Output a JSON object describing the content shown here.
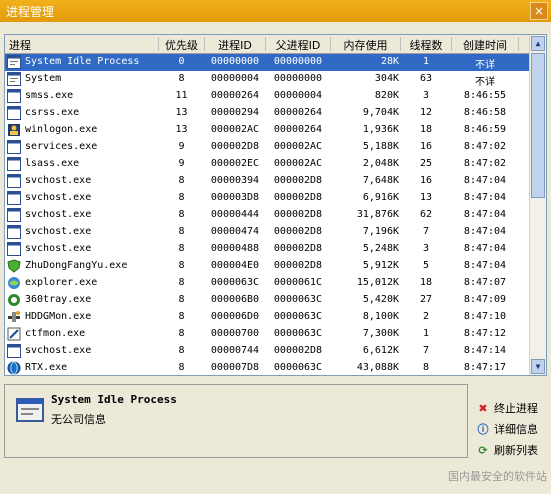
{
  "window": {
    "title": "进程管理",
    "close_label": "×"
  },
  "columns": [
    "进程",
    "优先级",
    "进程ID",
    "父进程ID",
    "内存使用",
    "线程数",
    "创建时间"
  ],
  "processes": [
    {
      "name": "System Idle Process",
      "priority": "0",
      "pid": "00000000",
      "ppid": "00000000",
      "mem": "28K",
      "threads": "1",
      "time": "不详",
      "icon": "window-icon"
    },
    {
      "name": "System",
      "priority": "8",
      "pid": "00000004",
      "ppid": "00000000",
      "mem": "304K",
      "threads": "63",
      "time": "不详",
      "icon": "window-icon"
    },
    {
      "name": "smss.exe",
      "priority": "11",
      "pid": "00000264",
      "ppid": "00000004",
      "mem": "820K",
      "threads": "3",
      "time": "8:46:55",
      "icon": "app-icon"
    },
    {
      "name": "csrss.exe",
      "priority": "13",
      "pid": "00000294",
      "ppid": "00000264",
      "mem": "9,704K",
      "threads": "12",
      "time": "8:46:58",
      "icon": "app-icon"
    },
    {
      "name": "winlogon.exe",
      "priority": "13",
      "pid": "000002AC",
      "ppid": "00000264",
      "mem": "1,936K",
      "threads": "18",
      "time": "8:46:59",
      "icon": "winlogon-icon"
    },
    {
      "name": "services.exe",
      "priority": "9",
      "pid": "000002D8",
      "ppid": "000002AC",
      "mem": "5,188K",
      "threads": "16",
      "time": "8:47:02",
      "icon": "app-icon"
    },
    {
      "name": "lsass.exe",
      "priority": "9",
      "pid": "000002EC",
      "ppid": "000002AC",
      "mem": "2,048K",
      "threads": "25",
      "time": "8:47:02",
      "icon": "app-icon"
    },
    {
      "name": "svchost.exe",
      "priority": "8",
      "pid": "00000394",
      "ppid": "000002D8",
      "mem": "7,648K",
      "threads": "16",
      "time": "8:47:04",
      "icon": "app-icon"
    },
    {
      "name": "svchost.exe",
      "priority": "8",
      "pid": "000003D8",
      "ppid": "000002D8",
      "mem": "6,916K",
      "threads": "13",
      "time": "8:47:04",
      "icon": "app-icon"
    },
    {
      "name": "svchost.exe",
      "priority": "8",
      "pid": "00000444",
      "ppid": "000002D8",
      "mem": "31,876K",
      "threads": "62",
      "time": "8:47:04",
      "icon": "app-icon"
    },
    {
      "name": "svchost.exe",
      "priority": "8",
      "pid": "00000474",
      "ppid": "000002D8",
      "mem": "7,196K",
      "threads": "7",
      "time": "8:47:04",
      "icon": "app-icon"
    },
    {
      "name": "svchost.exe",
      "priority": "8",
      "pid": "00000488",
      "ppid": "000002D8",
      "mem": "5,248K",
      "threads": "3",
      "time": "8:47:04",
      "icon": "app-icon"
    },
    {
      "name": "ZhuDongFangYu.exe",
      "priority": "8",
      "pid": "000004E0",
      "ppid": "000002D8",
      "mem": "5,912K",
      "threads": "5",
      "time": "8:47:04",
      "icon": "shield-icon"
    },
    {
      "name": "explorer.exe",
      "priority": "8",
      "pid": "0000063C",
      "ppid": "0000061C",
      "mem": "15,012K",
      "threads": "18",
      "time": "8:47:07",
      "icon": "explorer-icon"
    },
    {
      "name": "360tray.exe",
      "priority": "8",
      "pid": "000006B0",
      "ppid": "0000063C",
      "mem": "5,420K",
      "threads": "27",
      "time": "8:47:09",
      "icon": "tray-icon"
    },
    {
      "name": "HDDGMon.exe",
      "priority": "8",
      "pid": "000006D0",
      "ppid": "0000063C",
      "mem": "8,100K",
      "threads": "2",
      "time": "8:47:10",
      "icon": "tool-icon"
    },
    {
      "name": "ctfmon.exe",
      "priority": "8",
      "pid": "00000700",
      "ppid": "0000063C",
      "mem": "7,300K",
      "threads": "1",
      "time": "8:47:12",
      "icon": "pen-icon"
    },
    {
      "name": "svchost.exe",
      "priority": "8",
      "pid": "00000744",
      "ppid": "000002D8",
      "mem": "6,612K",
      "threads": "7",
      "time": "8:47:14",
      "icon": "app-icon"
    },
    {
      "name": "RTX.exe",
      "priority": "8",
      "pid": "000007D8",
      "ppid": "0000063C",
      "mem": "43,088K",
      "threads": "8",
      "time": "8:47:17",
      "icon": "globe-icon"
    }
  ],
  "detail": {
    "title": "System Idle Process",
    "company": "无公司信息"
  },
  "actions": {
    "terminate": "终止进程",
    "details": "详细信息",
    "refresh": "刷新列表"
  },
  "watermark": "国内最安全的软件站",
  "colors": {
    "title_bar": "#e39a08",
    "selection": "#316ac5"
  }
}
